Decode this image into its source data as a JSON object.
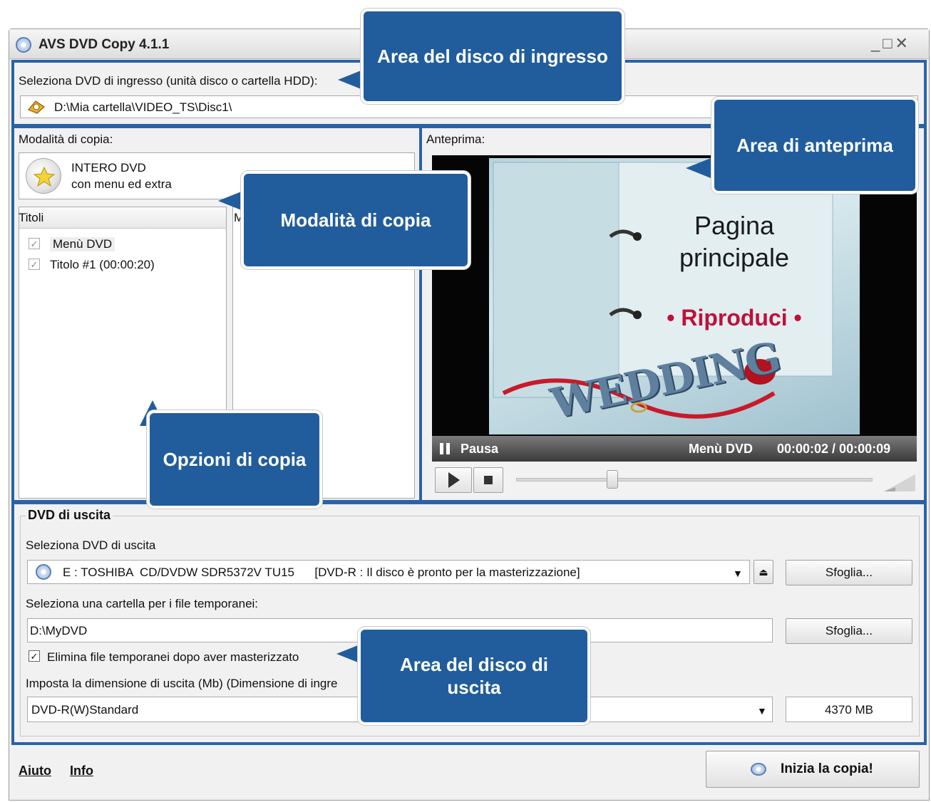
{
  "window": {
    "title": "AVS DVD Copy 4.1.1"
  },
  "input_area": {
    "label": "Seleziona DVD di ingresso (unità disco o cartella HDD):",
    "path": "D:\\Mia cartella\\VIDEO_TS\\Disc1\\"
  },
  "copy_mode": {
    "label": "Modalità di copia:",
    "mode_line1": "INTERO DVD",
    "mode_line2": "con menu ed extra"
  },
  "titles": {
    "header": "Titoli",
    "second_header": "M",
    "items": [
      {
        "label": "Menù DVD",
        "checked": true
      },
      {
        "label": "Titolo #1 (00:00:20)",
        "checked": true
      }
    ]
  },
  "preview": {
    "label": "Anteprima:",
    "screen_title_line1": "Pagina",
    "screen_title_line2": "principale",
    "screen_play": "• Riproduci •",
    "screen_logo": "WEDDING",
    "status_pause": "Pausa",
    "status_source": "Menù DVD",
    "status_time": "00:00:02 / 00:00:09",
    "seek_position": 0.27
  },
  "output": {
    "group_title": "DVD di uscita",
    "select_label": "Seleziona DVD di uscita",
    "drive_value": "E : TOSHIBA  CD/DVDW SDR5372V TU15      [DVD-R : Il disco è pronto per la masterizzazione]",
    "browse_label": "Sfoglia...",
    "temp_label": "Seleziona una cartella per i file temporanei:",
    "temp_value": "D:\\MyDVD",
    "delete_temp_label": "Elimina file temporanei dopo aver masterizzato",
    "delete_temp_checked": true,
    "size_label": "Imposta la dimensione di uscita (Mb) (Dimensione di ingre",
    "size_preset": "DVD-R(W)Standard",
    "size_value": "4370 MB"
  },
  "footer": {
    "help": "Aiuto",
    "info": "Info",
    "start": "Inizia la copia!"
  },
  "callouts": {
    "input": "Area del disco di ingresso",
    "preview": "Area di anteprima",
    "mode": "Modalità di copia",
    "options": "Opzioni di copia",
    "output": "Area del disco di uscita"
  },
  "colors": {
    "frame_blue": "#2a62a8",
    "callout_blue": "#215d9c",
    "play_red": "#c0103a"
  }
}
